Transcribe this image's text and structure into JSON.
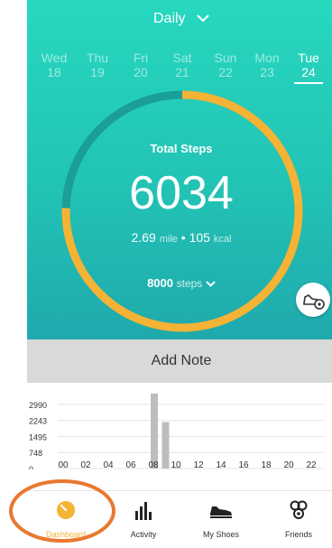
{
  "header": {
    "period": "Daily"
  },
  "days": [
    {
      "name": "Wed",
      "date": "18"
    },
    {
      "name": "Thu",
      "date": "19"
    },
    {
      "name": "Fri",
      "date": "20"
    },
    {
      "name": "Sat",
      "date": "21"
    },
    {
      "name": "Sun",
      "date": "22"
    },
    {
      "name": "Mon",
      "date": "23"
    },
    {
      "name": "Tue",
      "date": "24",
      "active": true
    }
  ],
  "summary": {
    "label": "Total Steps",
    "steps": "6034",
    "distance": "2.69",
    "distance_unit": "mile",
    "separator": "•",
    "calories": "105",
    "calories_unit": "kcal",
    "goal": "8000",
    "goal_unit": "steps",
    "progress_fraction": 0.754
  },
  "add_note": "Add Note",
  "chart_data": {
    "type": "bar",
    "y_ticks": [
      "2990",
      "2243",
      "1495",
      "748",
      "0"
    ],
    "x_ticks": [
      "00",
      "02",
      "04",
      "06",
      "08",
      "10",
      "12",
      "14",
      "16",
      "18",
      "20",
      "22"
    ],
    "ylim": [
      0,
      2990
    ],
    "hours": [
      0,
      1,
      2,
      3,
      4,
      5,
      6,
      7,
      8,
      9,
      10,
      11,
      12,
      13,
      14,
      15,
      16,
      17,
      18,
      19,
      20,
      21,
      22,
      23
    ],
    "values": [
      0,
      0,
      0,
      0,
      0,
      0,
      0,
      0,
      3500,
      2170,
      60,
      0,
      0,
      0,
      0,
      0,
      0,
      0,
      0,
      0,
      0,
      0,
      0,
      0
    ]
  },
  "tabs": [
    {
      "label": "Dashboard",
      "icon": "dashboard-icon",
      "active": true
    },
    {
      "label": "Activity",
      "icon": "activity-bars-icon"
    },
    {
      "label": "My Shoes",
      "icon": "shoe-icon"
    },
    {
      "label": "Friends",
      "icon": "friends-icon"
    }
  ],
  "colors": {
    "accent": "#f5b335",
    "ring_track": "#1a9e97",
    "teal_top": "#27d8bf",
    "bar": "#bdbdbd",
    "annotation": "#e8792f"
  }
}
